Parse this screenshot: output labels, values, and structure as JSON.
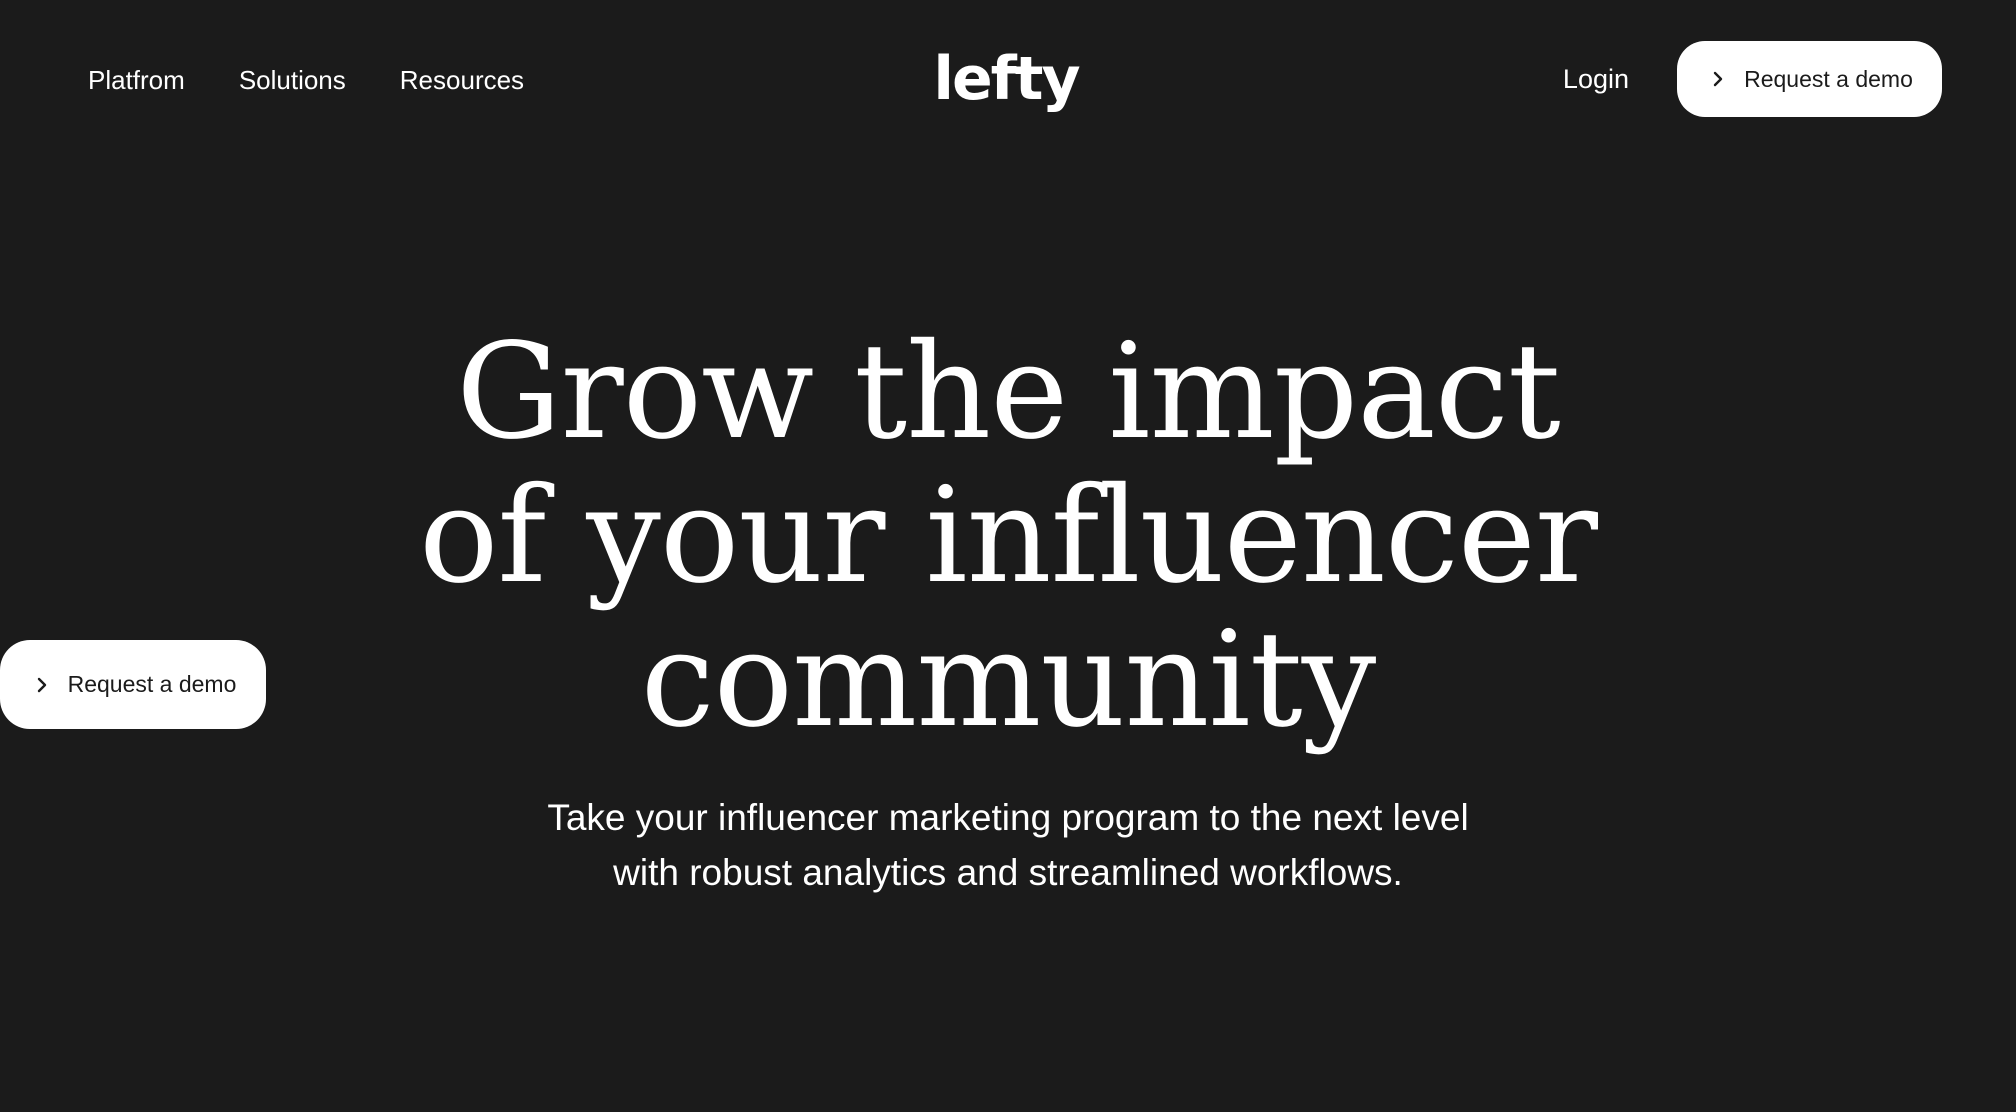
{
  "nav": {
    "items": [
      "Platfrom",
      "Solutions",
      "Resources"
    ],
    "login": "Login",
    "demo_label": "Request a demo"
  },
  "logo": {
    "text": "lefty"
  },
  "hero": {
    "title": "Grow the impact of your influencer community",
    "subtitle": "Take your influencer marketing program to the next level with robust analytics and streamlined workflows.",
    "cta_label": "Request a demo"
  },
  "icons": {
    "demo_icon": "chevron-right-icon"
  },
  "colors": {
    "background": "#1b1b1b",
    "text": "#ffffff",
    "button_bg": "#ffffff",
    "button_text": "#1b1b1b"
  }
}
